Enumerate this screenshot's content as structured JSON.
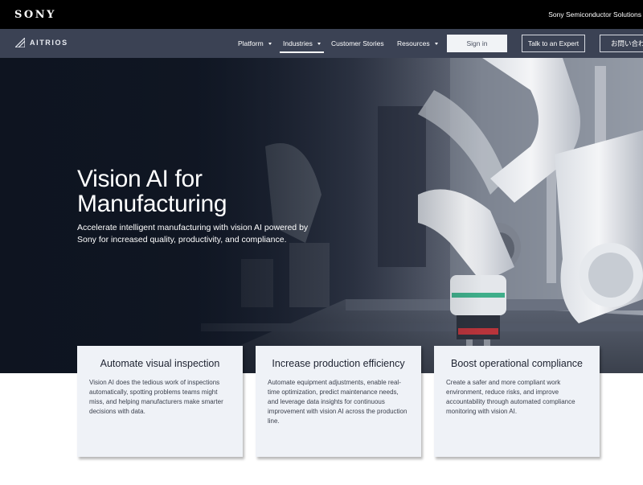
{
  "topbar": {
    "logo": "SONY",
    "right_label": "Sony Semiconductor Solutions"
  },
  "nav": {
    "brand": "AITRIOS",
    "items": [
      {
        "label": "Platform",
        "dropdown": true
      },
      {
        "label": "Industries",
        "dropdown": true,
        "active": true
      },
      {
        "label": "Customer Stories",
        "dropdown": false
      },
      {
        "label": "Resources",
        "dropdown": true
      }
    ],
    "sign_in": "Sign in",
    "talk_to_expert": "Talk to an Expert",
    "contact": "お問い合わせ"
  },
  "hero": {
    "title_line1": "Vision AI for",
    "title_line2": "Manufacturing",
    "subtitle": "Accelerate intelligent manufacturing with vision AI powered by Sony for increased quality, productivity, and compliance."
  },
  "cards": [
    {
      "title": "Automate visual inspection",
      "body": "Vision AI does the tedious work of inspections automatically, spotting problems teams might miss, and helping manufacturers make smarter decisions with data."
    },
    {
      "title": "Increase production efficiency",
      "body": "Automate equipment adjustments, enable real-time optimization, predict maintenance needs, and leverage data insights for continuous improvement with vision AI across the production line."
    },
    {
      "title": "Boost operational compliance",
      "body": "Create a safer and more compliant work environment, reduce risks, and improve accountability through automated compliance monitoring with vision AI."
    }
  ],
  "colors": {
    "top_bar": "#000000",
    "nav_bar": "#3b4254",
    "card_bg": "#eff2f7",
    "hero_dark": "#111827"
  }
}
